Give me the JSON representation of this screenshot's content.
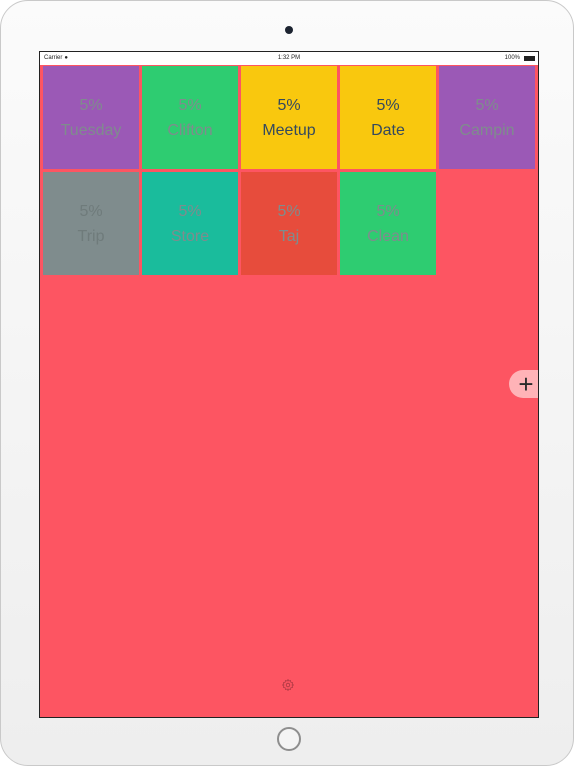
{
  "status_bar": {
    "carrier": "Carrier",
    "time": "1:32 PM",
    "battery": "100%"
  },
  "tiles": [
    {
      "percent": "5%",
      "label": "Tuesday",
      "bg": "#9b59b6",
      "fg": "#7f8c8d"
    },
    {
      "percent": "5%",
      "label": "Clifton",
      "bg": "#2ecc71",
      "fg": "#7f8c8d"
    },
    {
      "percent": "5%",
      "label": "Meetup",
      "bg": "#f9c80e",
      "fg": "#34495e"
    },
    {
      "percent": "5%",
      "label": "Date",
      "bg": "#f9c80e",
      "fg": "#34495e"
    },
    {
      "percent": "5%",
      "label": "Campin",
      "bg": "#9b59b6",
      "fg": "#7f8c8d"
    },
    {
      "percent": "5%",
      "label": "Trip",
      "bg": "#7f8c8d",
      "fg": "#6f7b7b"
    },
    {
      "percent": "5%",
      "label": "Store",
      "bg": "#1abc9c",
      "fg": "#7f8c8d"
    },
    {
      "percent": "5%",
      "label": "Taj",
      "bg": "#e74c3c",
      "fg": "#7f8c8d"
    },
    {
      "percent": "5%",
      "label": "Clean",
      "bg": "#2ecc71",
      "fg": "#7f8c8d"
    }
  ],
  "icons": {
    "add": "plus-icon",
    "settings": "gear-icon"
  },
  "colors": {
    "background": "#fd5562",
    "add_button": "#ffb3b7"
  }
}
